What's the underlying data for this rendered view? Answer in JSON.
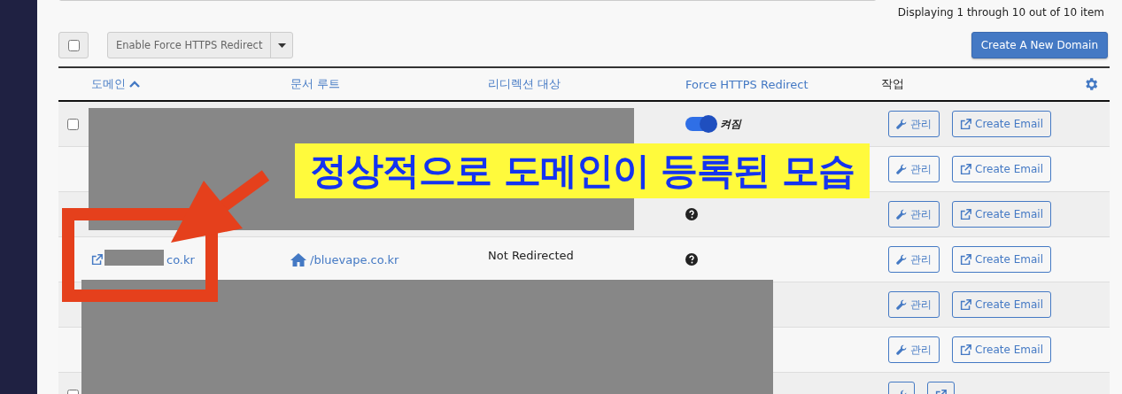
{
  "summary": "Displaying 1 through 10 out of 10 item",
  "toolbar": {
    "select_all": {
      "checked": false
    },
    "bulk_action": "Enable Force HTTPS Redirect",
    "create_button": "Create A New Domain"
  },
  "table": {
    "columns": [
      {
        "label": "도메인",
        "sorted": true
      },
      {
        "label": "문서 루트",
        "sorted": false
      },
      {
        "label": "리디렉션 대상",
        "sorted": false
      },
      {
        "label": "Force HTTPS Redirect",
        "sorted": false
      },
      {
        "label": "작업",
        "sorted": false
      }
    ],
    "rows": [
      {
        "checked": false,
        "https": {
          "kind": "toggle",
          "on": true,
          "label": "켜짐"
        },
        "manage": "관리",
        "email": "Create Email"
      },
      {
        "https": {
          "kind": "none"
        },
        "manage": "관리",
        "email": "Create Email"
      },
      {
        "https": {
          "kind": "unknown"
        },
        "manage": "관리",
        "email": "Create Email"
      },
      {
        "domain": "co.kr",
        "docroot": "/bluevape.co.kr",
        "redirect": "Not Redirected",
        "https": {
          "kind": "unknown"
        },
        "manage": "관리",
        "email": "Create Email"
      },
      {
        "https": {
          "kind": "none"
        },
        "manage": "관리",
        "email": "Create Email"
      },
      {
        "https": {
          "kind": "none"
        },
        "manage": "관리",
        "email": "Create Email"
      },
      {
        "checked": false,
        "https": {
          "kind": "none"
        }
      }
    ]
  },
  "annotation": {
    "caption": "정상적으로 도메인이 등록된 모습"
  }
}
